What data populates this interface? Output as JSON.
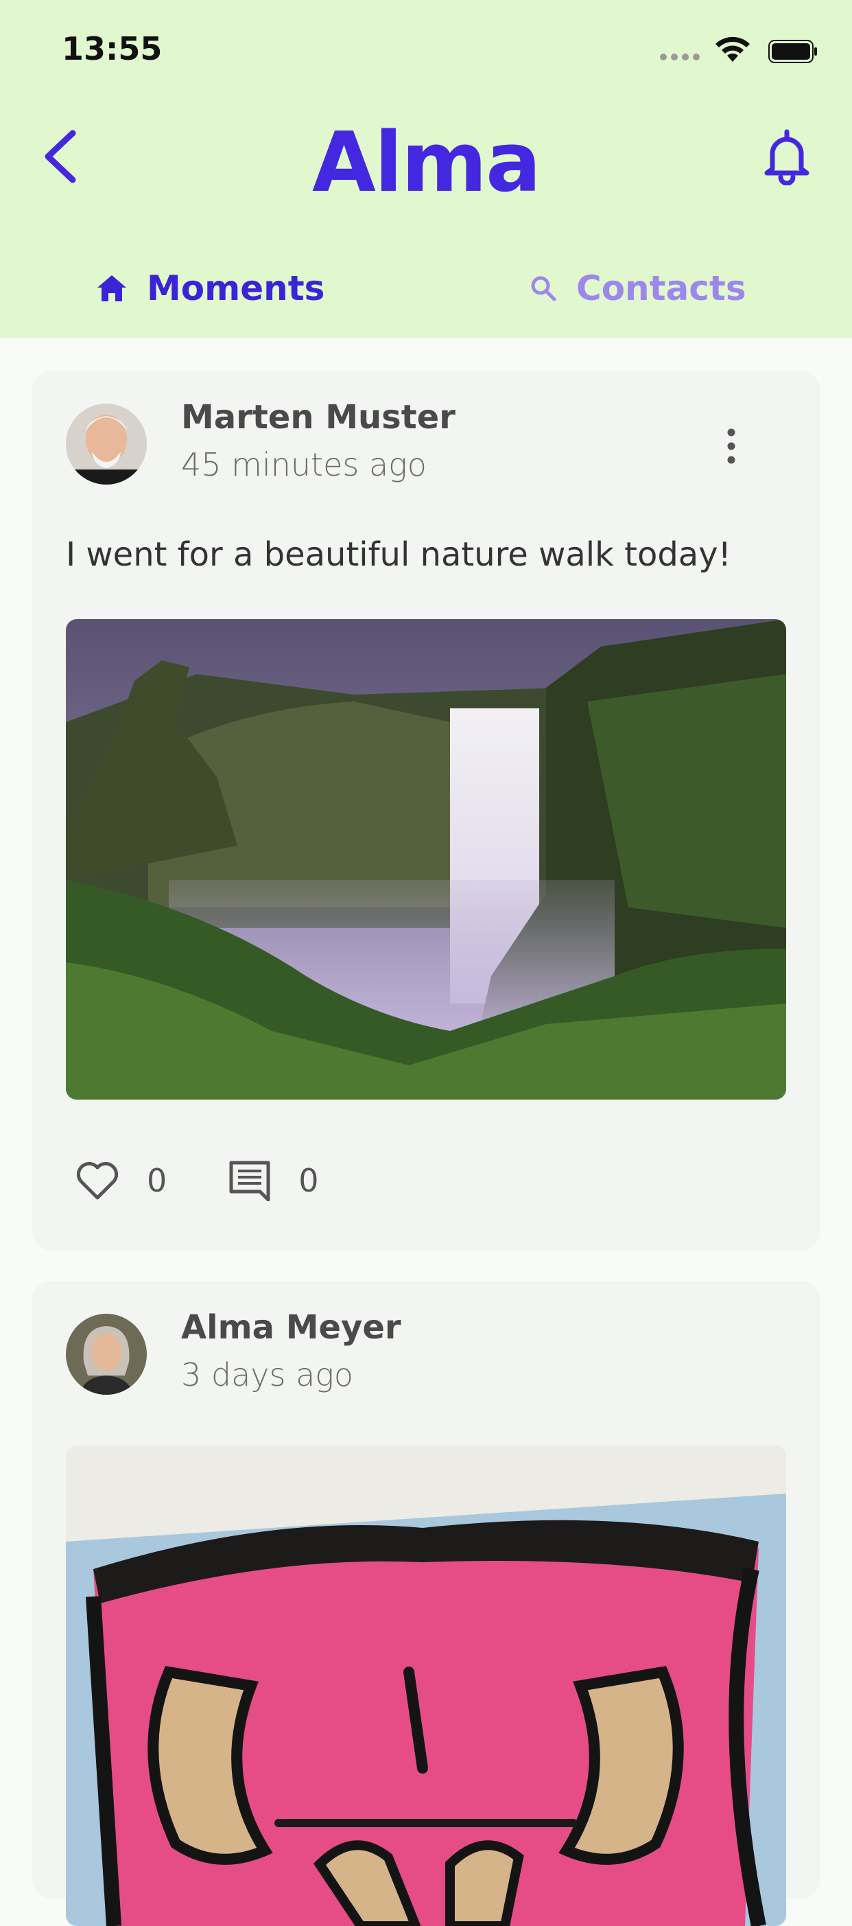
{
  "status_bar": {
    "time": "13:55"
  },
  "header": {
    "title": "Alma",
    "back_icon": "chevron-left-icon",
    "notification_icon": "bell-icon"
  },
  "tabs": [
    {
      "label": "Moments",
      "icon": "home-icon",
      "active": true
    },
    {
      "label": "Contacts",
      "icon": "search-icon",
      "active": false
    }
  ],
  "posts": [
    {
      "author": "Marten Muster",
      "time": "45 minutes ago",
      "text": "I went for a beautiful nature walk today!",
      "image": "waterfall landscape",
      "likes": "0",
      "comments": "0"
    },
    {
      "author": "Alma Meyer",
      "time": "3 days ago",
      "image": "painted face artwork"
    }
  ],
  "colors": {
    "accent": "#4428e0",
    "header_bg": "#e1f7cd",
    "inactive_tab": "#9c88ec"
  }
}
